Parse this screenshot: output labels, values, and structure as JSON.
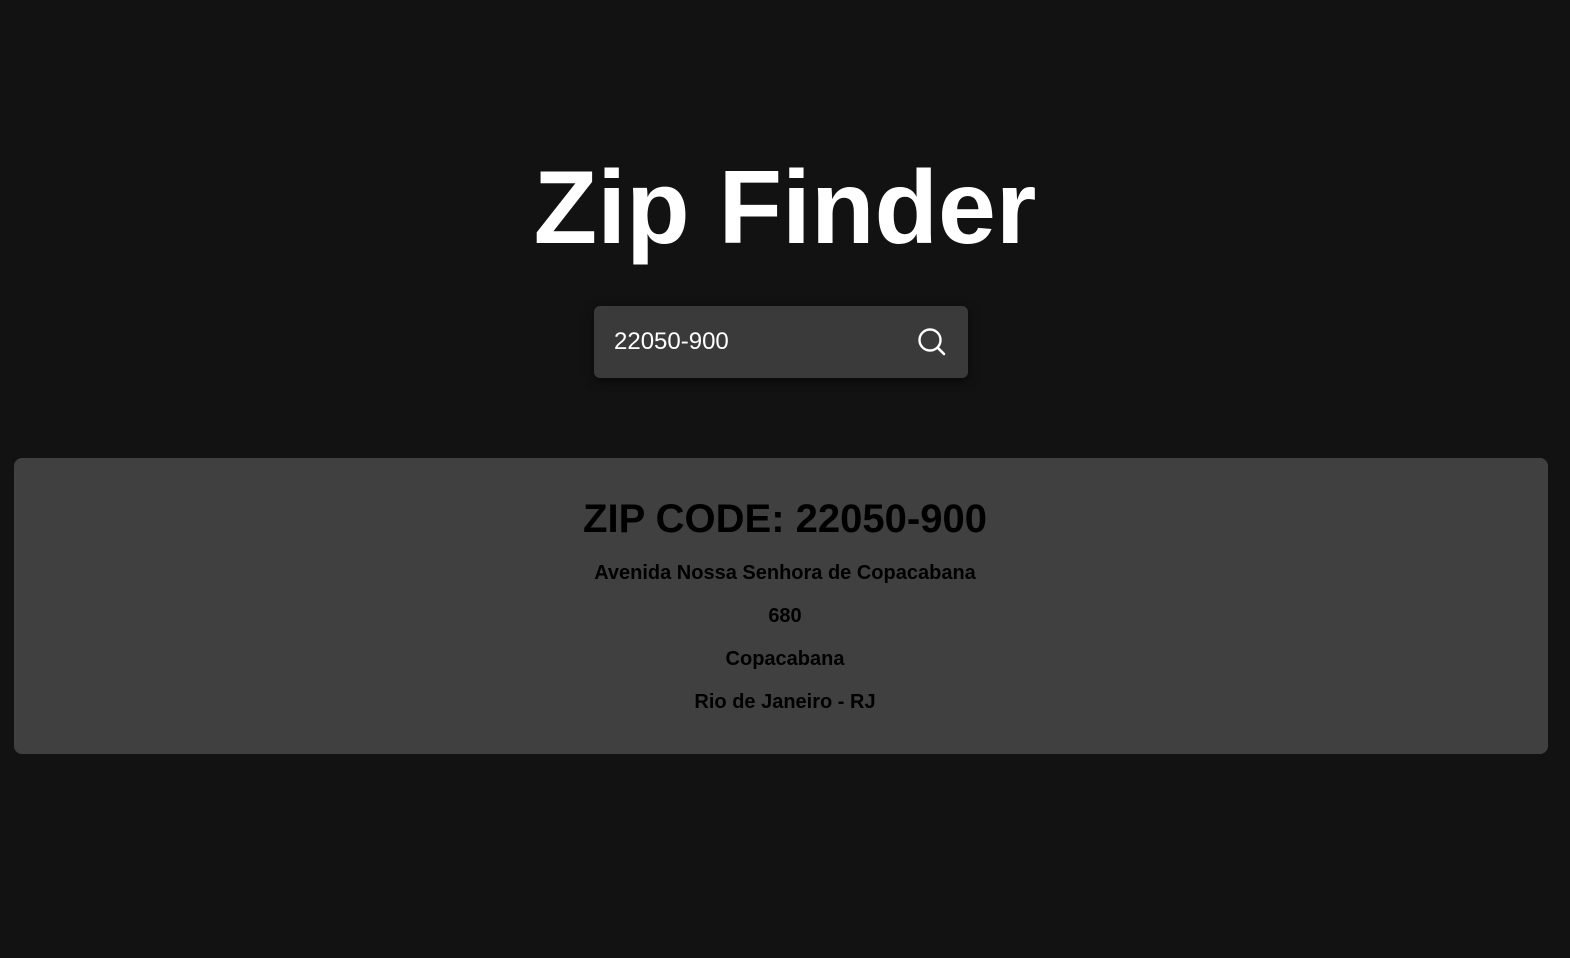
{
  "header": {
    "title": "Zip Finder"
  },
  "search": {
    "value": "22050-900",
    "icon": "search-icon"
  },
  "result": {
    "zip_label": "ZIP CODE:",
    "zip_value": "22050-900",
    "zip_heading": "ZIP CODE: 22050-900",
    "street": "Avenida Nossa Senhora de Copacabana",
    "number": "680",
    "neighborhood": "Copacabana",
    "city_state": "Rio de Janeiro - RJ"
  },
  "colors": {
    "background": "#121212",
    "search_background": "#3a3a3a",
    "card_background": "#404040",
    "title_text": "#ffffff",
    "result_text": "#000000"
  }
}
